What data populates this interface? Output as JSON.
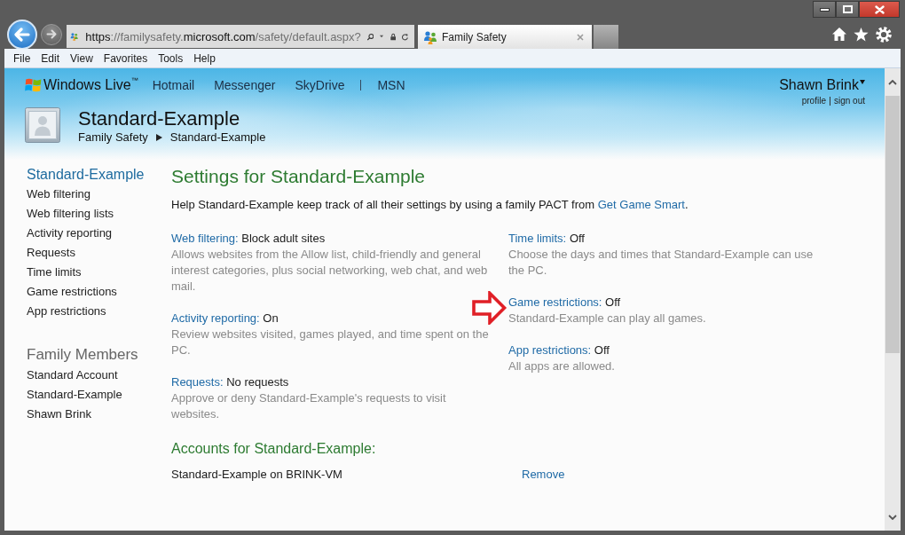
{
  "browser": {
    "address": "**https**://familysafety.**microsoft.com**/safety/default.aspx?",
    "tabs": [
      {
        "label": "Family Safety",
        "selected": true
      }
    ],
    "menu": [
      "File",
      "Edit",
      "View",
      "Favorites",
      "Tools",
      "Help"
    ]
  },
  "header": {
    "brand": "Windows Live$^{™}$",
    "nav_groups": [
      [
        "Hotmail",
        "Messenger",
        "SkyDrive"
      ],
      [
        "MSN"
      ]
    ],
    "user": {
      "name": "Shawn Brink",
      "links": [
        "profile",
        "sign out"
      ]
    }
  },
  "profile": {
    "name": "Standard-Example",
    "breadcrumb": [
      "Family Safety",
      "Standard-Example"
    ]
  },
  "sidebar": {
    "title": "Standard-Example",
    "items": [
      "Web filtering",
      "Web filtering lists",
      "Activity reporting",
      "Requests",
      "Time limits",
      "Game restrictions",
      "App restrictions"
    ],
    "members_title": "Family Members",
    "members": [
      "Standard Account",
      "Standard-Example",
      "Shawn Brink"
    ]
  },
  "main": {
    "title": "Settings for Standard-Example",
    "intro": {
      "text": "Help Standard-Example keep track of all their settings by using a family PACT from",
      "link": "Get Game Smart",
      "after": "."
    },
    "setting_columns": [
      [
        {
          "label": "Web filtering:",
          "value": "Block adult sites",
          "description": "Allows websites from the Allow list, child-friendly and general interest categories, plus social networking, web chat, and web mail.",
          "marked": false
        },
        {
          "label": "Activity reporting:",
          "value": "On",
          "description": "Review websites visited, games played, and time spent on the PC.",
          "marked": false
        },
        {
          "label": "Requests:",
          "value": "No requests",
          "description": "Approve or deny Standard-Example's requests to visit websites.",
          "marked": false
        }
      ],
      [
        {
          "label": "Time limits:",
          "value": "Off",
          "description": "Choose the days and times that Standard-Example can use the PC.",
          "marked": false
        },
        {
          "label": "Game restrictions:",
          "value": "Off",
          "description": "Standard-Example can play all games.",
          "marked": true
        },
        {
          "label": "App restrictions:",
          "value": "Off",
          "description": "All apps are allowed.",
          "marked": false
        }
      ]
    ],
    "accounts_title": "Accounts for Standard-Example:",
    "accounts": [
      {
        "name": "Standard-Example on BRINK-VM",
        "action": "Remove"
      }
    ]
  }
}
